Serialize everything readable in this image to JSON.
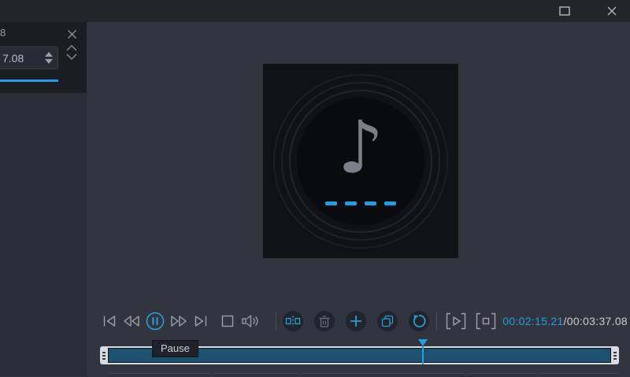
{
  "window": {
    "maximize_icon": "maximize-icon",
    "close_icon": "close-icon"
  },
  "left_panel": {
    "clipped_label": "8",
    "duration_field": {
      "value": "7.08"
    },
    "close_icon": "close-icon",
    "collapse_icon": "chevron-up-icon",
    "expand_icon": "chevron-down-icon"
  },
  "player": {
    "note_glyph": "♪",
    "loading_dash_count": 4
  },
  "toolbar": {
    "transport": [
      "previous",
      "rewind",
      "pause",
      "fast-forward",
      "next",
      "stop",
      "volume"
    ],
    "active_button": "pause",
    "edit_buttons": [
      "split",
      "delete",
      "add",
      "copy",
      "undo"
    ],
    "disabled_button": "delete",
    "segment_buttons": [
      "play-segment",
      "stop-segment"
    ],
    "time_current": "00:02:15.21",
    "time_separator": "/",
    "time_total": "00:03:37.08"
  },
  "timeline": {
    "tooltip": "Pause",
    "playhead_position_pct": 62.2
  },
  "colors": {
    "accent": "#1e9fe8",
    "icon_blue": "#2e9bd6",
    "icon_gray": "#9ea1a9",
    "timeline_fill": "#1c5270",
    "title_bar": "#23252d",
    "sidebar": "#2b2d36",
    "panel_dark": "#1b1d25",
    "main_bg": "#33353e",
    "art_bg": "#101217"
  }
}
